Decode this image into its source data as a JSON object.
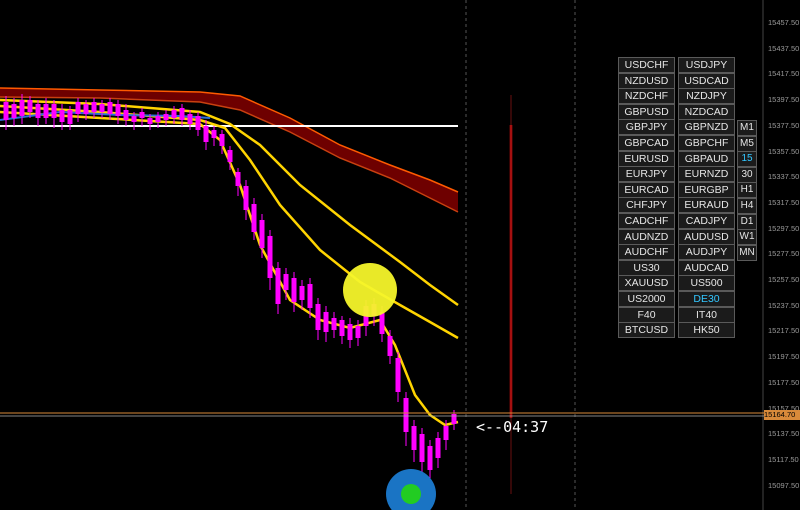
{
  "price_axis": {
    "ticks": [
      "15457.50",
      "15437.50",
      "15417.50",
      "15397.50",
      "15377.50",
      "15357.50",
      "15337.50",
      "15317.50",
      "15297.50",
      "15277.50",
      "15257.50",
      "15237.50",
      "15217.50",
      "15197.50",
      "15177.50",
      "15157.50",
      "15137.50",
      "15117.50",
      "15097.50"
    ],
    "current_price": "15164.70"
  },
  "countdown": "<--04:37",
  "symbol_buttons": [
    [
      "USDCHF",
      "USDJPY"
    ],
    [
      "NZDUSD",
      "USDCAD"
    ],
    [
      "NZDCHF",
      "NZDJPY"
    ],
    [
      "GBPUSD",
      "NZDCAD"
    ],
    [
      "GBPJPY",
      "GBPNZD"
    ],
    [
      "GBPCAD",
      "GBPCHF"
    ],
    [
      "EURUSD",
      "GBPAUD"
    ],
    [
      "EURJPY",
      "EURNZD"
    ],
    [
      "EURCAD",
      "EURGBP"
    ],
    [
      "CHFJPY",
      "EURAUD"
    ],
    [
      "CADCHF",
      "CADJPY"
    ],
    [
      "AUDNZD",
      "AUDUSD"
    ],
    [
      "AUDCHF",
      "AUDJPY"
    ],
    [
      "US30",
      "AUDCAD"
    ],
    [
      "XAUUSD",
      "US500"
    ],
    [
      "US2000",
      "DE30"
    ],
    [
      "F40",
      "IT40"
    ],
    [
      "BTCUSD",
      "HK50"
    ]
  ],
  "active_symbol": "DE30",
  "timeframe_buttons": [
    "M1",
    "M5",
    "15",
    "30",
    "H1",
    "H4",
    "D1",
    "W1",
    "MN"
  ],
  "active_timeframe": "15",
  "colors": {
    "bull_candle": "#ff00ff",
    "bear_candle": "#ff00ff",
    "band_yellow": "#ffd400",
    "cloud_dark_red": "#6e0000",
    "cloud_edge": "#ff5a00",
    "vertical_marker": "#e01010",
    "highlight_yellow": "#f5f52a",
    "circle_blue": "#1a74c4",
    "circle_green": "#22cc22",
    "price_line": "#d88a3a"
  }
}
